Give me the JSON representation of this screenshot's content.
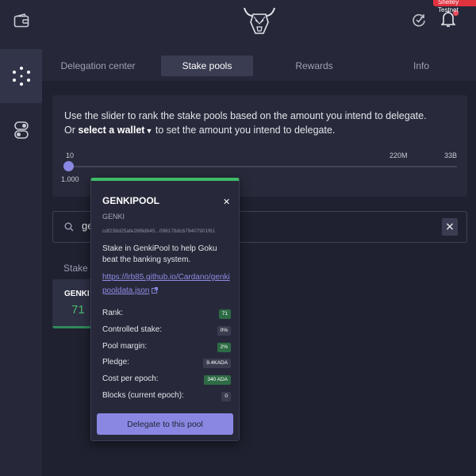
{
  "network_badge": "Shelley Testnet",
  "tabs": [
    {
      "label": "Delegation center"
    },
    {
      "label": "Stake pools"
    },
    {
      "label": "Rewards"
    },
    {
      "label": "Info"
    }
  ],
  "instructions": {
    "line1": "Use the slider to rank the stake pools based on the amount you intend to delegate.",
    "line2_prefix": "Or",
    "line2_link": "select a wallet",
    "line2_suffix": "to set the amount you intend to delegate."
  },
  "slider": {
    "min_label": "10",
    "value_label": "1.000",
    "mid_label": "220M",
    "max_label": "33B",
    "position": 0.0
  },
  "search": {
    "value": "genki"
  },
  "results": {
    "title": "Stake pools (1)"
  },
  "pool_card": {
    "ticker": "GENKI",
    "rank": "71"
  },
  "tooltip": {
    "name": "GENKIPOOL",
    "ticker": "GENKI",
    "pool_id": "cdf239d25afe26f8db45...096178dcb79407901f61",
    "description": "Stake in GenkiPool to help Goku beat the banking system.",
    "url": "https://lrb85.github.io/Cardano/genkipooldata.json",
    "rows": [
      {
        "label": "Rank:",
        "value": "71"
      },
      {
        "label": "Controlled stake:",
        "value": "0%"
      },
      {
        "label": "Pool margin:",
        "value": "2%"
      },
      {
        "label": "Pledge:",
        "value": "9.4KADA"
      },
      {
        "label": "Cost per epoch:",
        "value": "340 ADA"
      },
      {
        "label": "Blocks (current epoch):",
        "value": "0"
      }
    ],
    "delegate_label": "Delegate to this pool"
  },
  "icons": {
    "wallet": "wallet-icon",
    "stake": "stake-pools-icon",
    "settings": "settings-toggle-icon",
    "logo": "bull-logo-icon",
    "sync": "sync-icon",
    "bell": "notification-bell-icon",
    "search": "search-icon",
    "close": "close-icon",
    "external": "external-link-icon"
  },
  "colors": {
    "accent": "#8a87e3",
    "success": "#3fbb68",
    "alert": "#e1333f",
    "background": "#1f2130"
  }
}
